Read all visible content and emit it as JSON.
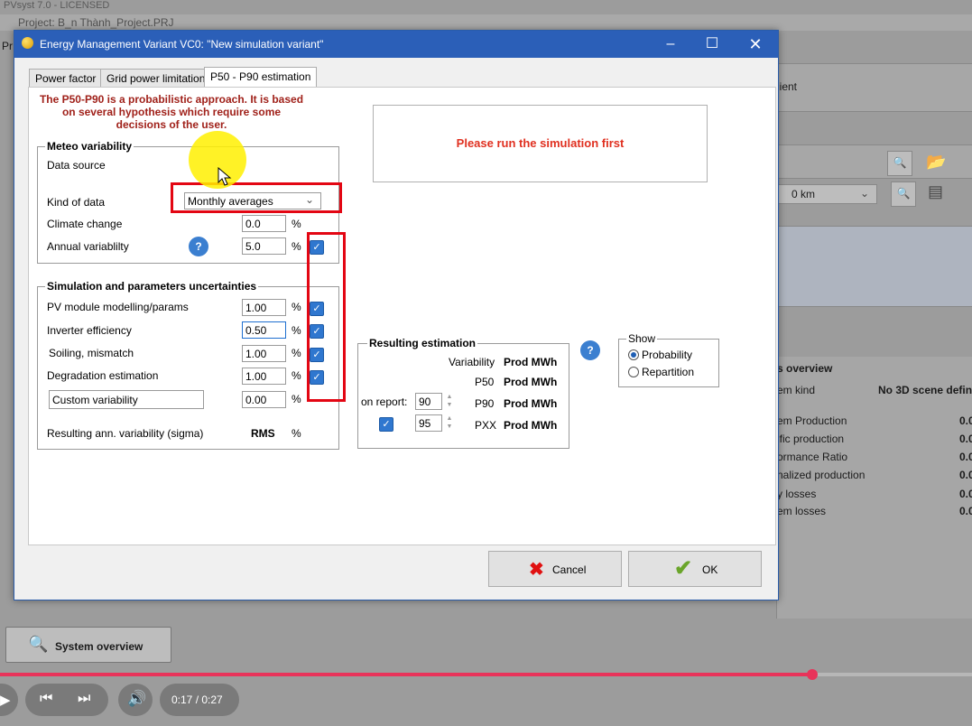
{
  "background_app": {
    "title": "PVsyst 7.0 - LICENSED",
    "project": "Project: B_n Thành_Project.PRJ",
    "left_fragment": "Pr",
    "client_fragment": "lient",
    "distance_value": "0 km",
    "overview_title": "s overview",
    "system_kind_label": "em kind",
    "system_kind_value": "No 3D scene defin",
    "overview_rows": [
      {
        "label": "em Production",
        "value": "0.0"
      },
      {
        "label": "ific production",
        "value": "0.0"
      },
      {
        "label": "ormance Ratio",
        "value": "0.0"
      },
      {
        "label": "nalized production",
        "value": "0.0"
      },
      {
        "label": "y losses",
        "value": "0.0"
      },
      {
        "label": "em losses",
        "value": "0.0"
      }
    ],
    "system_overview_button": "System overview"
  },
  "dialog": {
    "title": "Energy Management Variant VC0:  \"New simulation variant\"",
    "tabs": [
      "Power factor",
      "Grid power limitation",
      "P50 - P90 estimation"
    ],
    "active_tab": 2,
    "intro_text": "The P50-P90 is a probabilistic approach. It is based on several hypothesis which require some decisions of the user.",
    "run_first_message": "Please run the simulation first",
    "meteo": {
      "legend": "Meteo variability",
      "data_source_label": "Data source",
      "kind_label": "Kind of data",
      "kind_value": "Monthly averages",
      "climate_label": "Climate change",
      "climate_value": "0.0",
      "annual_label": "Annual variablilty",
      "annual_value": "5.0",
      "unit": "%"
    },
    "uncertainties": {
      "legend": "Simulation and parameters uncertainties",
      "rows": [
        {
          "label": "PV module modelling/params",
          "value": "1.00"
        },
        {
          "label": "Inverter efficiency",
          "value": "0.50"
        },
        {
          "label": "Soiling, mismatch",
          "value": "1.00"
        },
        {
          "label": "Degradation estimation",
          "value": "1.00"
        }
      ],
      "custom_label": "Custom variability",
      "custom_value": "0.00",
      "unit": "%",
      "result_label": "Resulting ann. variability (sigma)",
      "result_rms": "RMS",
      "result_unit": "%"
    },
    "resulting": {
      "legend": "Resulting estimation",
      "variability_label": "Variability",
      "p50_label": "P50",
      "p90_label": "P90",
      "pxx_label": "PXX",
      "prod_unit": "Prod MWh",
      "on_report_label": "on report:",
      "report_value": "90",
      "pxx_value": "95"
    },
    "show": {
      "legend": "Show",
      "options": [
        "Probability",
        "Repartition"
      ],
      "selected": 0
    },
    "cancel_label": "Cancel",
    "ok_label": "OK"
  },
  "video": {
    "time": "0:17 / 0:27",
    "progress_fraction": 0.836
  }
}
